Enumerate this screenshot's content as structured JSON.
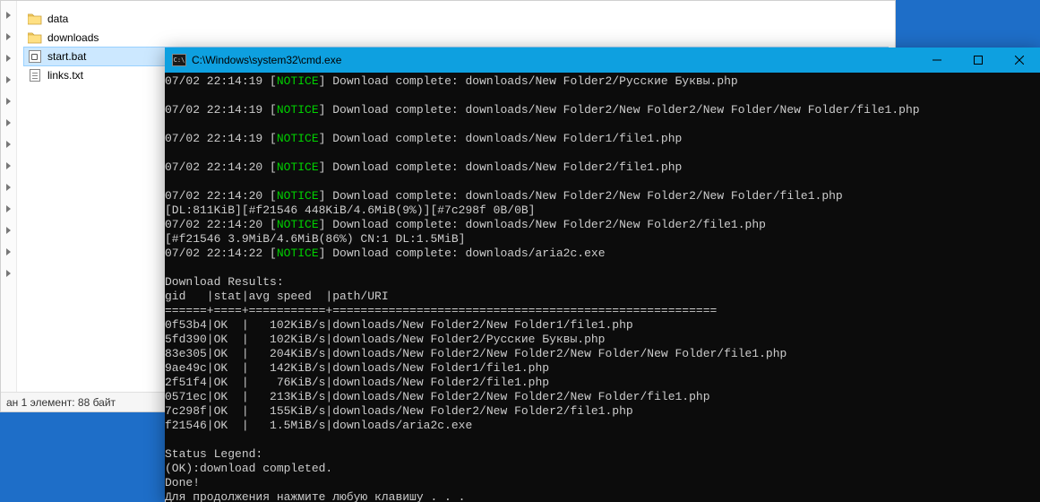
{
  "explorer": {
    "files": [
      {
        "name": "data",
        "type": "folder"
      },
      {
        "name": "downloads",
        "type": "folder"
      },
      {
        "name": "start.bat",
        "type": "bat",
        "selected": true
      },
      {
        "name": "links.txt",
        "type": "txt"
      }
    ],
    "status": "ан 1 элемент: 88 байт"
  },
  "cmd": {
    "title": "C:\\Windows\\system32\\cmd.exe",
    "notice_label": "NOTICE",
    "lines": [
      {
        "ts": "07/02 22:14:19",
        "kind": "notice",
        "rest": " Download complete: downloads/New Folder2/Русские Буквы.php"
      },
      {
        "kind": "blank"
      },
      {
        "ts": "07/02 22:14:19",
        "kind": "notice",
        "rest": " Download complete: downloads/New Folder2/New Folder2/New Folder/New Folder/file1.php"
      },
      {
        "kind": "blank"
      },
      {
        "ts": "07/02 22:14:19",
        "kind": "notice",
        "rest": " Download complete: downloads/New Folder1/file1.php"
      },
      {
        "kind": "blank"
      },
      {
        "ts": "07/02 22:14:20",
        "kind": "notice",
        "rest": " Download complete: downloads/New Folder2/file1.php"
      },
      {
        "kind": "blank"
      },
      {
        "ts": "07/02 22:14:20",
        "kind": "notice",
        "rest": " Download complete: downloads/New Folder2/New Folder2/New Folder/file1.php"
      },
      {
        "kind": "plain",
        "text": "[DL:811KiB][#f21546 448KiB/4.6MiB(9%)][#7c298f 0B/0B]"
      },
      {
        "ts": "07/02 22:14:20",
        "kind": "notice",
        "rest": " Download complete: downloads/New Folder2/New Folder2/file1.php"
      },
      {
        "kind": "plain",
        "text": "[#f21546 3.9MiB/4.6MiB(86%) CN:1 DL:1.5MiB]"
      },
      {
        "ts": "07/02 22:14:22",
        "kind": "notice",
        "rest": " Download complete: downloads/aria2c.exe"
      },
      {
        "kind": "blank"
      },
      {
        "kind": "plain",
        "text": "Download Results:"
      },
      {
        "kind": "plain",
        "text": "gid   |stat|avg speed  |path/URI"
      },
      {
        "kind": "plain",
        "text": "======+====+===========+======================================================="
      },
      {
        "kind": "plain",
        "text": "0f53b4|OK  |   102KiB/s|downloads/New Folder2/New Folder1/file1.php"
      },
      {
        "kind": "plain",
        "text": "5fd390|OK  |   102KiB/s|downloads/New Folder2/Русские Буквы.php"
      },
      {
        "kind": "plain",
        "text": "83e305|OK  |   204KiB/s|downloads/New Folder2/New Folder2/New Folder/New Folder/file1.php"
      },
      {
        "kind": "plain",
        "text": "9ae49c|OK  |   142KiB/s|downloads/New Folder1/file1.php"
      },
      {
        "kind": "plain",
        "text": "2f51f4|OK  |    76KiB/s|downloads/New Folder2/file1.php"
      },
      {
        "kind": "plain",
        "text": "0571ec|OK  |   213KiB/s|downloads/New Folder2/New Folder2/New Folder/file1.php"
      },
      {
        "kind": "plain",
        "text": "7c298f|OK  |   155KiB/s|downloads/New Folder2/New Folder2/file1.php"
      },
      {
        "kind": "plain",
        "text": "f21546|OK  |   1.5MiB/s|downloads/aria2c.exe"
      },
      {
        "kind": "blank"
      },
      {
        "kind": "plain",
        "text": "Status Legend:"
      },
      {
        "kind": "plain",
        "text": "(OK):download completed."
      },
      {
        "kind": "plain",
        "text": "Done!"
      },
      {
        "kind": "plain",
        "text": "Для продолжения нажмите любую клавишу . . ."
      }
    ]
  }
}
